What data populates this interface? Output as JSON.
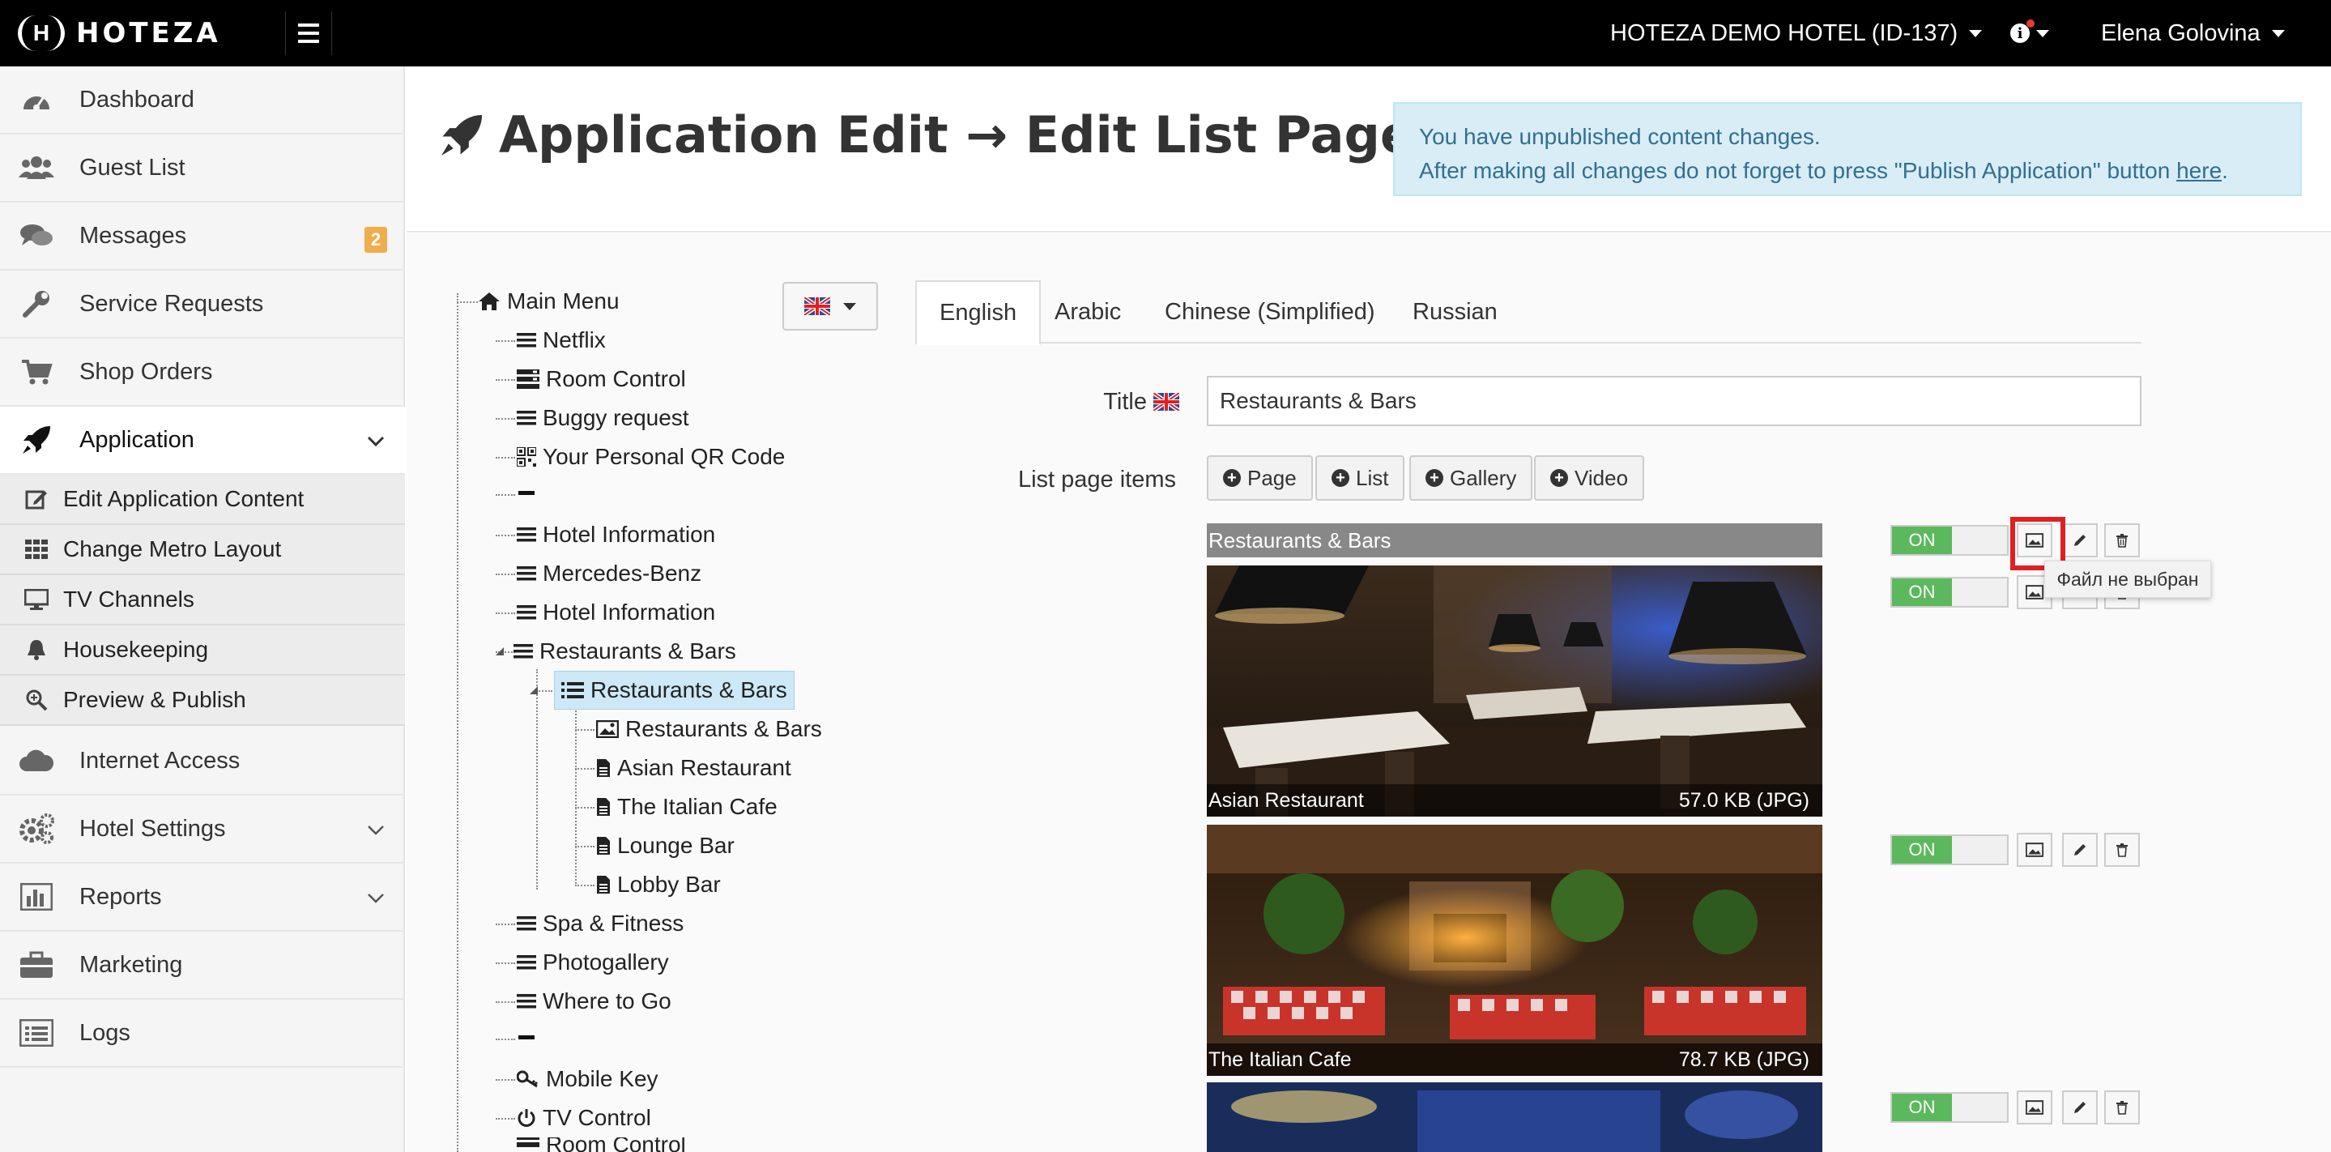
{
  "brand": {
    "name": "HOTEZA",
    "mark": "(H)"
  },
  "topbar": {
    "hotel": "HOTEZA DEMO HOTEL (ID-137)",
    "user": "Elena Golovina",
    "info_icon": "info-icon"
  },
  "sidebar": {
    "items": [
      {
        "label": "Dashboard",
        "icon": "dashboard-icon"
      },
      {
        "label": "Guest List",
        "icon": "users-icon"
      },
      {
        "label": "Messages",
        "icon": "comments-icon",
        "badge": "2"
      },
      {
        "label": "Service Requests",
        "icon": "wrench-icon"
      },
      {
        "label": "Shop Orders",
        "icon": "cart-icon"
      },
      {
        "label": "Application",
        "icon": "rocket-icon"
      },
      {
        "label": "Internet Access",
        "icon": "cloud-icon"
      },
      {
        "label": "Hotel Settings",
        "icon": "gears-icon"
      },
      {
        "label": "Reports",
        "icon": "bar-chart-icon"
      },
      {
        "label": "Marketing",
        "icon": "briefcase-icon"
      },
      {
        "label": "Logs",
        "icon": "list-icon"
      }
    ],
    "subitems": [
      {
        "label": "Edit Application Content",
        "icon": "edit-icon"
      },
      {
        "label": "Change Metro Layout",
        "icon": "grid-icon"
      },
      {
        "label": "TV Channels",
        "icon": "monitor-icon"
      },
      {
        "label": "Housekeeping",
        "icon": "bell-icon"
      },
      {
        "label": "Preview & Publish",
        "icon": "zoom-icon"
      }
    ]
  },
  "header": {
    "title": "Application Edit → Edit List Page",
    "alert_line1": "You have unpublished content changes.",
    "alert_line2": "After making all changes do not forget to press \"Publish Application\" button ",
    "alert_link": "here",
    "alert_end": "."
  },
  "tree": {
    "root": "Main Menu",
    "nodes": [
      "Netflix",
      "Room Control",
      "Buggy request",
      "Your Personal QR Code",
      "Hotel Information",
      "Mercedes-Benz",
      "Hotel Information",
      "Restaurants & Bars",
      "Restaurants & Bars",
      "Restaurants & Bars",
      "Asian Restaurant",
      "The Italian Cafe",
      "Lounge Bar",
      "Lobby Bar",
      "Spa & Fitness",
      "Photogallery",
      "Where to Go",
      "Mobile Key",
      "TV Control",
      "Room Control"
    ]
  },
  "tabs": [
    "English",
    "Arabic",
    "Chinese (Simplified)",
    "Russian"
  ],
  "form": {
    "title_label": "Title",
    "title_value": "Restaurants & Bars",
    "items_label": "List page items",
    "buttons": [
      "Page",
      "List",
      "Gallery",
      "Video"
    ]
  },
  "list": {
    "header_item": "Restaurants & Bars",
    "toggle_label": "ON",
    "tooltip": "Файл не выбран",
    "cards": [
      {
        "name": "Asian Restaurant",
        "size": "57.0 KB (JPG)"
      },
      {
        "name": "The Italian Cafe",
        "size": "78.7 KB (JPG)"
      }
    ]
  },
  "colors": {
    "topbar": "#000000",
    "alert_bg": "#d9edf7",
    "alert_text": "#31708f",
    "toggle_on": "#5cb85c",
    "badge": "#f0ad4e",
    "highlight": "#e02020"
  }
}
